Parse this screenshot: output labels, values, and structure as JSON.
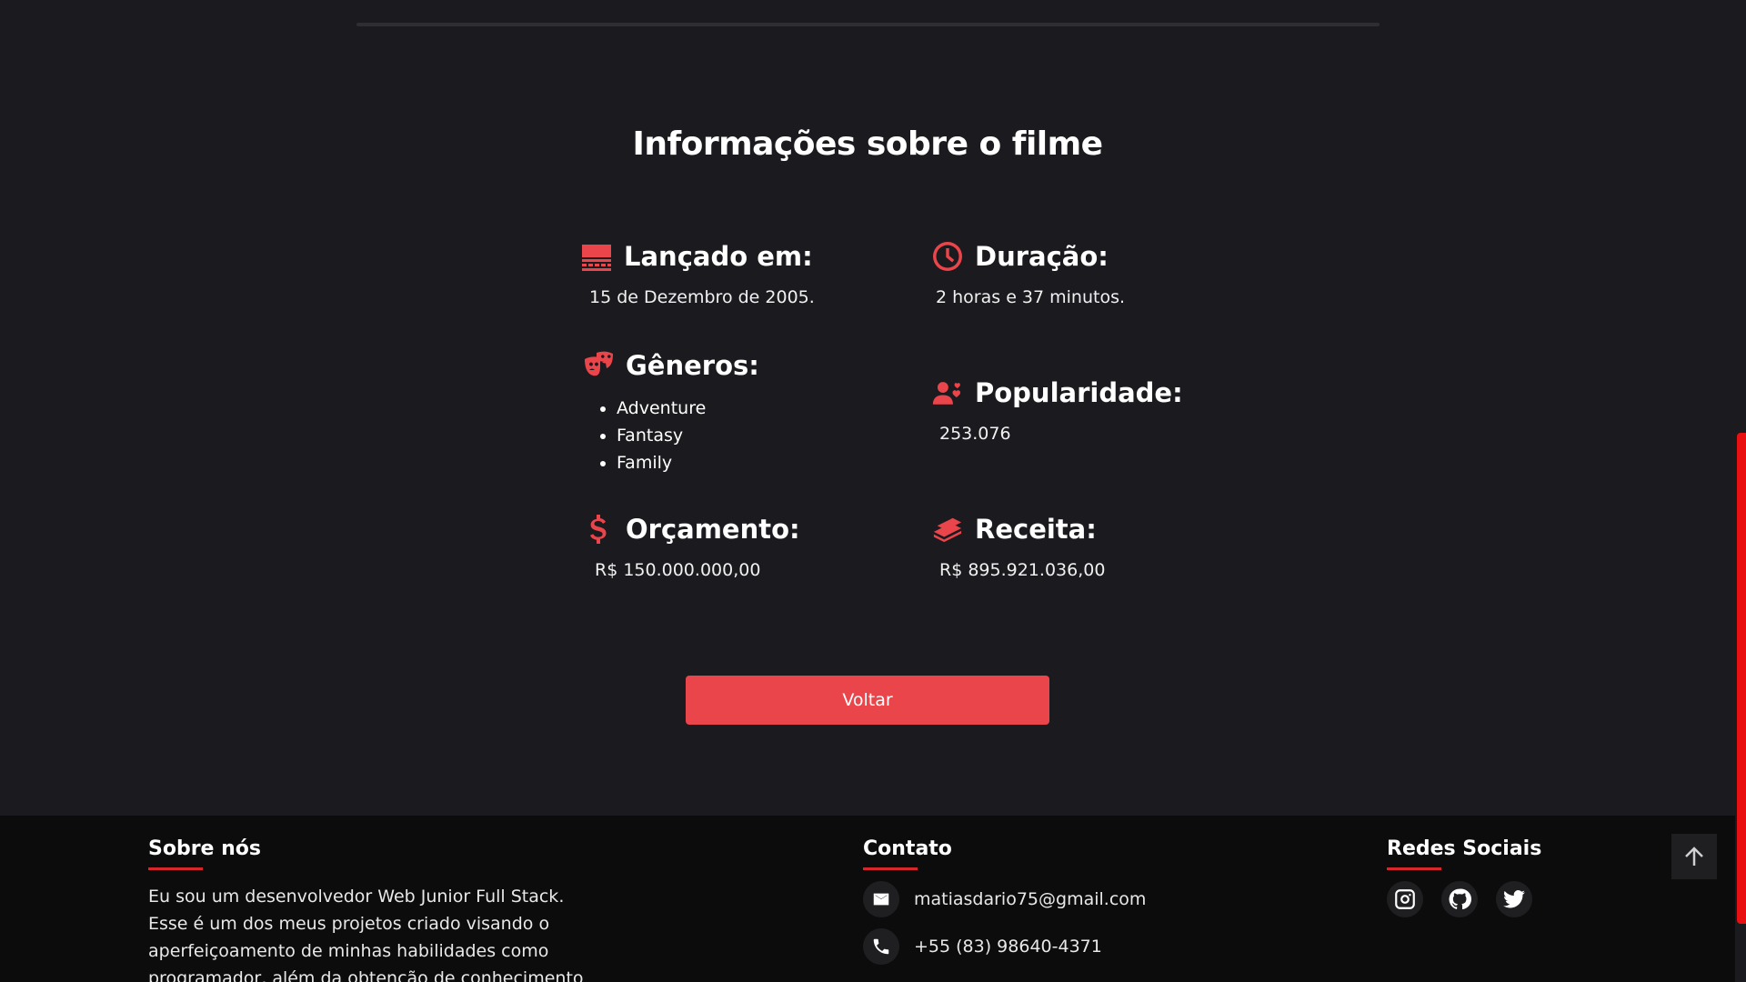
{
  "section": {
    "title": "Informações sobre o filme"
  },
  "info": {
    "release": {
      "label": "Lançado em:",
      "value": "15 de Dezembro de 2005.",
      "icon": "calendar-icon"
    },
    "duration": {
      "label": "Duração:",
      "value": "2 horas e 37 minutos.",
      "icon": "clock-icon"
    },
    "genres": {
      "label": "Gêneros:",
      "items": [
        "Adventure",
        "Fantasy",
        "Family"
      ],
      "icon": "theater-masks-icon"
    },
    "popularity": {
      "label": "Popularidade:",
      "value": "253.076",
      "icon": "users-heart-icon"
    },
    "budget": {
      "label": "Orçamento:",
      "value": "R$ 150.000.000,00",
      "icon": "dollar-icon"
    },
    "revenue": {
      "label": "Receita:",
      "value": "R$ 895.921.036,00",
      "icon": "money-stack-icon"
    }
  },
  "actions": {
    "back_label": "Voltar"
  },
  "footer": {
    "about": {
      "title": "Sobre nós",
      "text": "Eu sou um desenvolvedor Web Junior Full Stack. Esse é um dos meus projetos criado visando o aperfeiçoamento de minhas habilidades como programador, além da obtenção de conhecimento"
    },
    "contact": {
      "title": "Contato",
      "email": "matiasdario75@gmail.com",
      "phone": "+55 (83) 98640-4371"
    },
    "social": {
      "title": "Redes Sociais",
      "icons": [
        "instagram-icon",
        "github-icon",
        "twitter-icon"
      ]
    }
  },
  "colors": {
    "accent": "#e9454a",
    "background": "#1b1a1e",
    "footer_bg": "#0c0c0d",
    "scrollbar": "#e81010"
  }
}
